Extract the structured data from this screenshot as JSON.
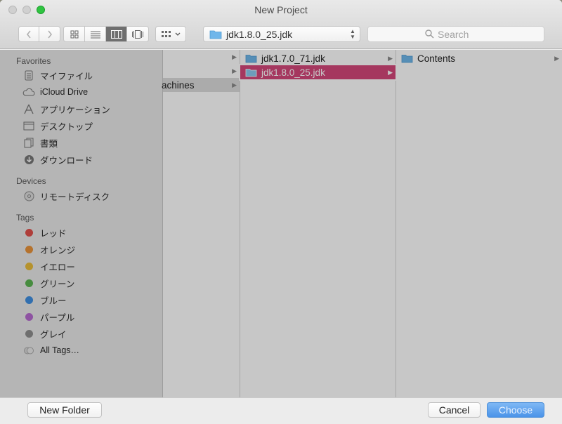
{
  "window": {
    "title": "New Project"
  },
  "toolbar": {
    "back_icon": "chevron-left-icon",
    "forward_icon": "chevron-right-icon",
    "view_modes": [
      "icon-view",
      "list-view",
      "column-view",
      "coverflow-view"
    ],
    "active_view": "column-view",
    "arrange_icon": "grid-arrange-icon",
    "path_popup": "jdk1.8.0_25.jdk",
    "search_placeholder": "Search"
  },
  "sidebar": {
    "favorites_header": "Favorites",
    "favorites": [
      {
        "label": "マイファイル",
        "icon": "all-my-files-icon"
      },
      {
        "label": "iCloud Drive",
        "icon": "cloud-icon"
      },
      {
        "label": "アプリケーション",
        "icon": "applications-icon"
      },
      {
        "label": "デスクトップ",
        "icon": "desktop-icon"
      },
      {
        "label": "書類",
        "icon": "documents-icon"
      },
      {
        "label": "ダウンロード",
        "icon": "downloads-icon"
      }
    ],
    "devices_header": "Devices",
    "devices": [
      {
        "label": "リモートディスク",
        "icon": "remote-disc-icon"
      }
    ],
    "tags_header": "Tags",
    "tags": [
      {
        "label": "レッド",
        "color": "#e0504b"
      },
      {
        "label": "オレンジ",
        "color": "#e8923a"
      },
      {
        "label": "イエロー",
        "color": "#e8bc3a"
      },
      {
        "label": "グリーン",
        "color": "#5bb451"
      },
      {
        "label": "ブルー",
        "color": "#3f8fe0"
      },
      {
        "label": "パープル",
        "color": "#b66bd0"
      },
      {
        "label": "グレイ",
        "color": "#8e8e8e"
      },
      {
        "label": "All Tags…",
        "color": "#d8d8d8"
      }
    ]
  },
  "columns": {
    "col1": [
      {
        "label": ""
      },
      {
        "label": ""
      }
    ],
    "col2": [
      {
        "label": "achines"
      }
    ],
    "col3": [
      {
        "label": "jdk1.7.0_71.jdk",
        "selected": false
      },
      {
        "label": "jdk1.8.0_25.jdk",
        "selected": true
      }
    ],
    "col4": [
      {
        "label": "Contents"
      }
    ]
  },
  "colors": {
    "selection": "#d4477a",
    "folder": "#6fb6ea",
    "accent_button": "#4a93e8"
  },
  "buttons": {
    "new_folder": "New Folder",
    "cancel": "Cancel",
    "choose": "Choose"
  }
}
